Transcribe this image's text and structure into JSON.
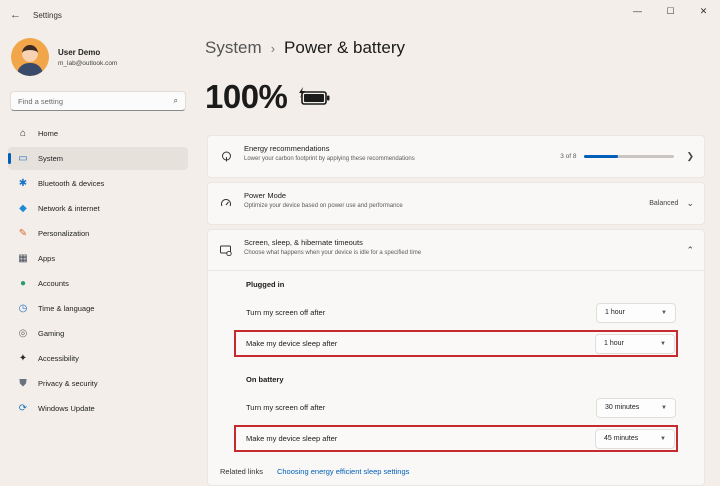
{
  "window": {
    "back_icon": "←",
    "title": "Settings",
    "minimize": "—",
    "maximize": "☐",
    "close": "✕"
  },
  "user": {
    "name": "User Demo",
    "email": "m_lab@outlook.com"
  },
  "search": {
    "placeholder": "Find a setting",
    "icon": "⌕"
  },
  "sidebar": {
    "items": [
      {
        "label": "Home",
        "icon": "⌂",
        "color": "#2b2b2b"
      },
      {
        "label": "System",
        "icon": "▭",
        "color": "#1a73c8"
      },
      {
        "label": "Bluetooth & devices",
        "icon": "✱",
        "color": "#1a73c8"
      },
      {
        "label": "Network & internet",
        "icon": "◆",
        "color": "#1d8ad6"
      },
      {
        "label": "Personalization",
        "icon": "✎",
        "color": "#d46a2a"
      },
      {
        "label": "Apps",
        "icon": "▦",
        "color": "#444c58"
      },
      {
        "label": "Accounts",
        "icon": "●",
        "color": "#2a9a6a"
      },
      {
        "label": "Time & language",
        "icon": "◷",
        "color": "#1a73c8"
      },
      {
        "label": "Gaming",
        "icon": "◎",
        "color": "#6a6a6a"
      },
      {
        "label": "Accessibility",
        "icon": "✦",
        "color": "#2b2b2b"
      },
      {
        "label": "Privacy & security",
        "icon": "⛊",
        "color": "#6a7280"
      },
      {
        "label": "Windows Update",
        "icon": "⟳",
        "color": "#1a73c8"
      }
    ]
  },
  "breadcrumb": {
    "parent": "System",
    "separator": "›",
    "current": "Power & battery"
  },
  "battery": {
    "percent": "100%",
    "charge_level": 1.0
  },
  "energy": {
    "title": "Energy recommendations",
    "desc": "Lower your carbon footprint by applying these recommendations",
    "progress_text": "3 of 8",
    "progress_fraction": 0.375
  },
  "power_mode": {
    "title": "Power Mode",
    "desc": "Optimize your device based on power use and performance",
    "value": "Balanced"
  },
  "timeouts": {
    "title": "Screen, sleep, & hibernate timeouts",
    "desc": "Choose what happens when your device is idle for a specified time",
    "plugged_in": {
      "heading": "Plugged in",
      "screen_label": "Turn my screen off after",
      "screen_value": "1 hour",
      "sleep_label": "Make my device sleep after",
      "sleep_value": "1 hour"
    },
    "on_battery": {
      "heading": "On battery",
      "screen_label": "Turn my screen off after",
      "screen_value": "30 minutes",
      "sleep_label": "Make my device sleep after",
      "sleep_value": "45 minutes"
    }
  },
  "related": {
    "label": "Related links",
    "link": "Choosing energy efficient sleep settings"
  },
  "colors": {
    "accent": "#005fb8",
    "highlight_border": "#c62a2f"
  }
}
